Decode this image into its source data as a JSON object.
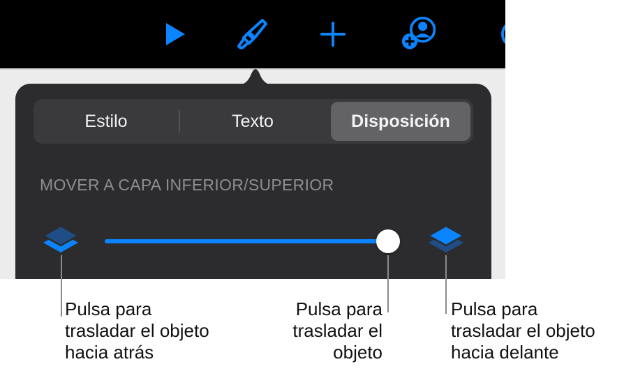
{
  "toolbar": {
    "icons": [
      "play-icon",
      "paintbrush-icon",
      "plus-icon",
      "add-collaborator-icon"
    ],
    "accent_color": "#0a84ff"
  },
  "popover": {
    "tabs": [
      {
        "label": "Estilo",
        "selected": false
      },
      {
        "label": "Texto",
        "selected": false
      },
      {
        "label": "Disposición",
        "selected": true
      }
    ],
    "section_header": "MOVER A CAPA INFERIOR/SUPERIOR",
    "slider": {
      "value": 1.0
    },
    "colors": {
      "background": "#2c2c2e",
      "accent": "#0a84ff"
    }
  },
  "callouts": {
    "backward": {
      "lines": [
        "Pulsa para",
        "trasladar el objeto",
        "hacia atrás"
      ]
    },
    "slider": {
      "lines": [
        "Pulsa para",
        "trasladar el",
        "objeto"
      ]
    },
    "forward": {
      "lines": [
        "Pulsa para",
        "trasladar el objeto",
        "hacia delante"
      ]
    }
  }
}
